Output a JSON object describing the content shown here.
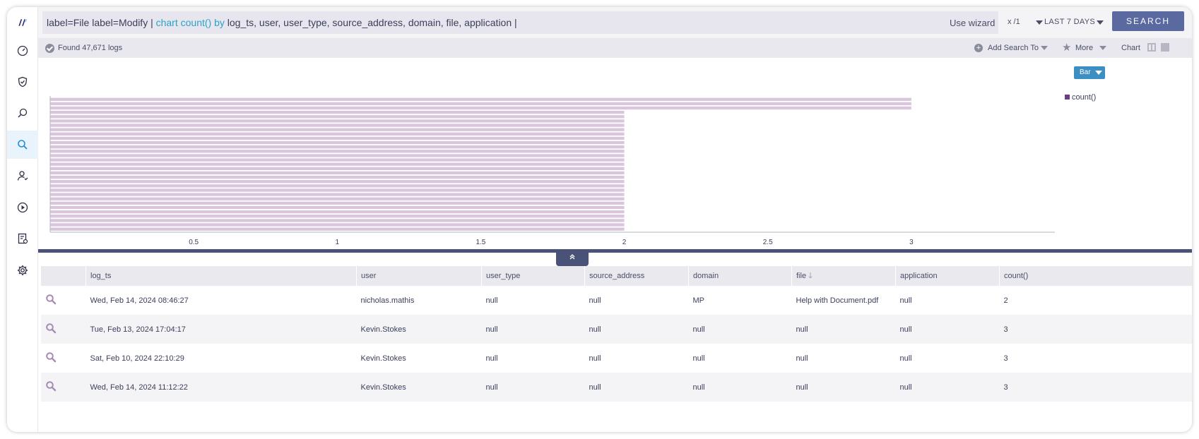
{
  "query": {
    "parts": [
      {
        "text": "label=File label=Modify | ",
        "kw": false
      },
      {
        "text": "chart count()",
        "kw": true
      },
      {
        "text": " ",
        "kw": false
      },
      {
        "text": "by",
        "kw": true
      },
      {
        "text": " log_ts, user, user_type, source_address, domain, file, application |",
        "kw": false
      }
    ],
    "use_wizard": "Use wizard",
    "repo": "x /1",
    "time_range": "LAST 7 DAYS",
    "search_label": "SEARCH"
  },
  "status": {
    "found": "Found 47,671 logs",
    "add_search": "Add Search To",
    "more": "More",
    "chart": "Chart"
  },
  "chart_controls": {
    "type_select": "Bar",
    "legend": "count()"
  },
  "chart_data": {
    "type": "bar",
    "orientation": "horizontal",
    "xlim": [
      0,
      3.5
    ],
    "xticks": [
      "0.5",
      "1",
      "1.5",
      "2",
      "2.5",
      "3"
    ],
    "series": [
      {
        "name": "count()",
        "color": "#d9c6dd"
      }
    ],
    "bars_count_value_3": 3,
    "bars_count_value_2": 28,
    "values": [
      3,
      3,
      3,
      2,
      2,
      2,
      2,
      2,
      2,
      2,
      2,
      2,
      2,
      2,
      2,
      2,
      2,
      2,
      2,
      2,
      2,
      2,
      2,
      2,
      2,
      2,
      2,
      2,
      2,
      2,
      2
    ]
  },
  "table": {
    "columns": [
      "log_ts",
      "user",
      "user_type",
      "source_address",
      "domain",
      "file",
      "application",
      "count()"
    ],
    "rows": [
      [
        "Wed, Feb 14, 2024 08:46:27",
        "nicholas.mathis",
        "null",
        "null",
        "MP",
        "Help with Document.pdf",
        "null",
        "2"
      ],
      [
        "Tue, Feb 13, 2024 17:04:17",
        "Kevin.Stokes",
        "null",
        "null",
        "null",
        "null",
        "null",
        "3"
      ],
      [
        "Sat, Feb 10, 2024 22:10:29",
        "Kevin.Stokes",
        "null",
        "null",
        "null",
        "null",
        "null",
        "3"
      ],
      [
        "Wed, Feb 14, 2024 11:12:22",
        "Kevin.Stokes",
        "null",
        "null",
        "null",
        "null",
        "null",
        "3"
      ]
    ]
  }
}
